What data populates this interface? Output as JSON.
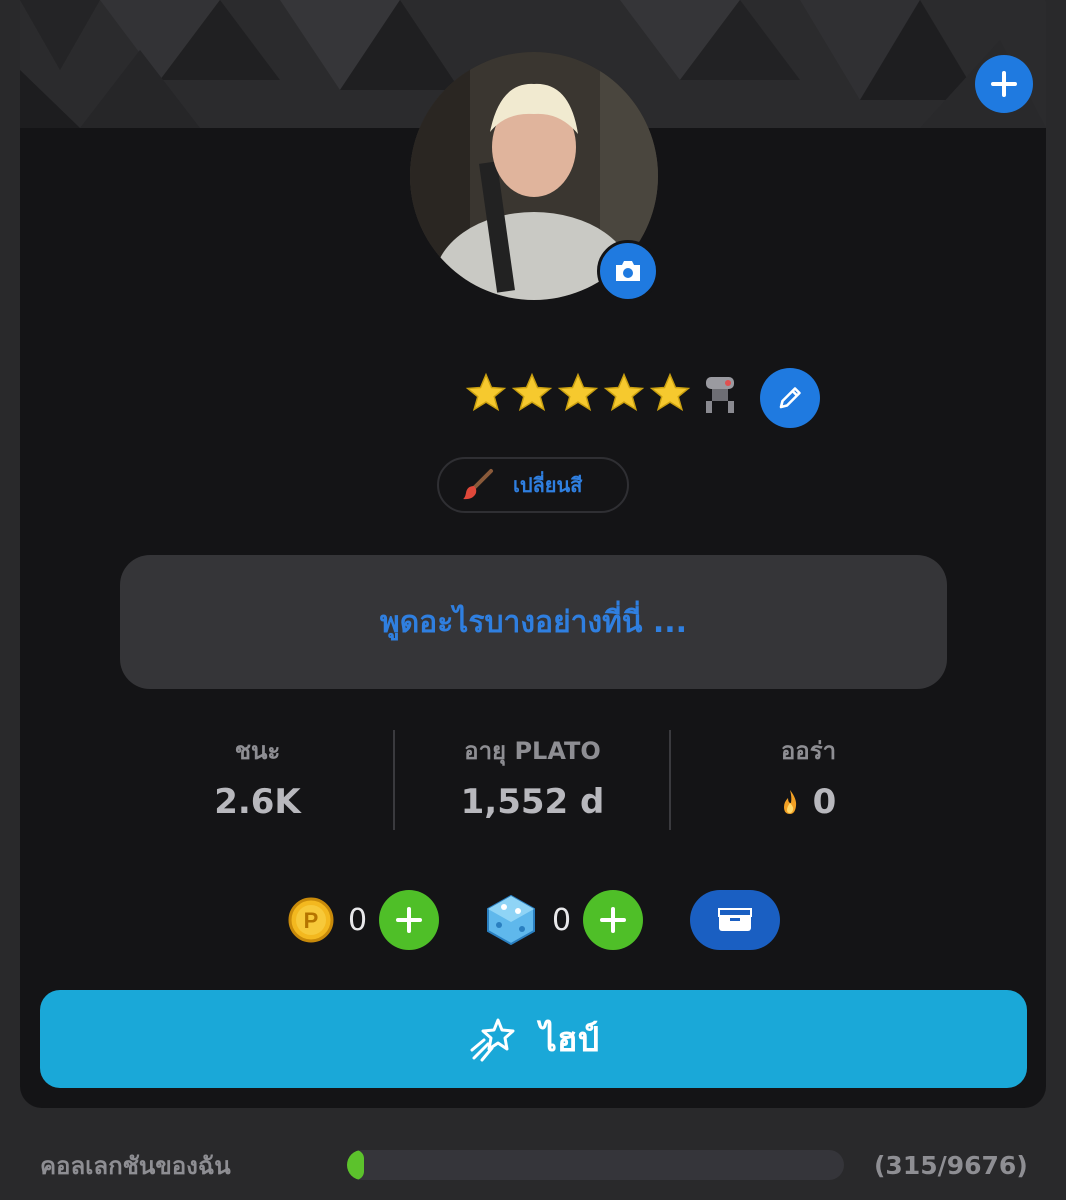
{
  "profile": {
    "avatar_description": "profile-photo",
    "stars_count": 5,
    "change_color_label": "เปลี่ยนสี",
    "status_placeholder": "พูดอะไรบางอย่างที่นี่ ..."
  },
  "stats": [
    {
      "label": "ชนะ",
      "value": "2.6K"
    },
    {
      "label": "อายุ PLATO",
      "value": "1,552 d"
    },
    {
      "label": "ออร่า",
      "value": "0",
      "icon": "flame-icon"
    }
  ],
  "currency": {
    "coins": "0",
    "gems": "0"
  },
  "hype_button": {
    "label": "ไฮป์"
  },
  "collection": {
    "label": "คอลเลกชันของฉัน",
    "count_text": "(315/9676)",
    "progress_fraction": 0.0326
  },
  "colors": {
    "accent_blue": "#1f7ae0",
    "green": "#4fbf28",
    "hype_cyan": "#1aa8d8"
  }
}
